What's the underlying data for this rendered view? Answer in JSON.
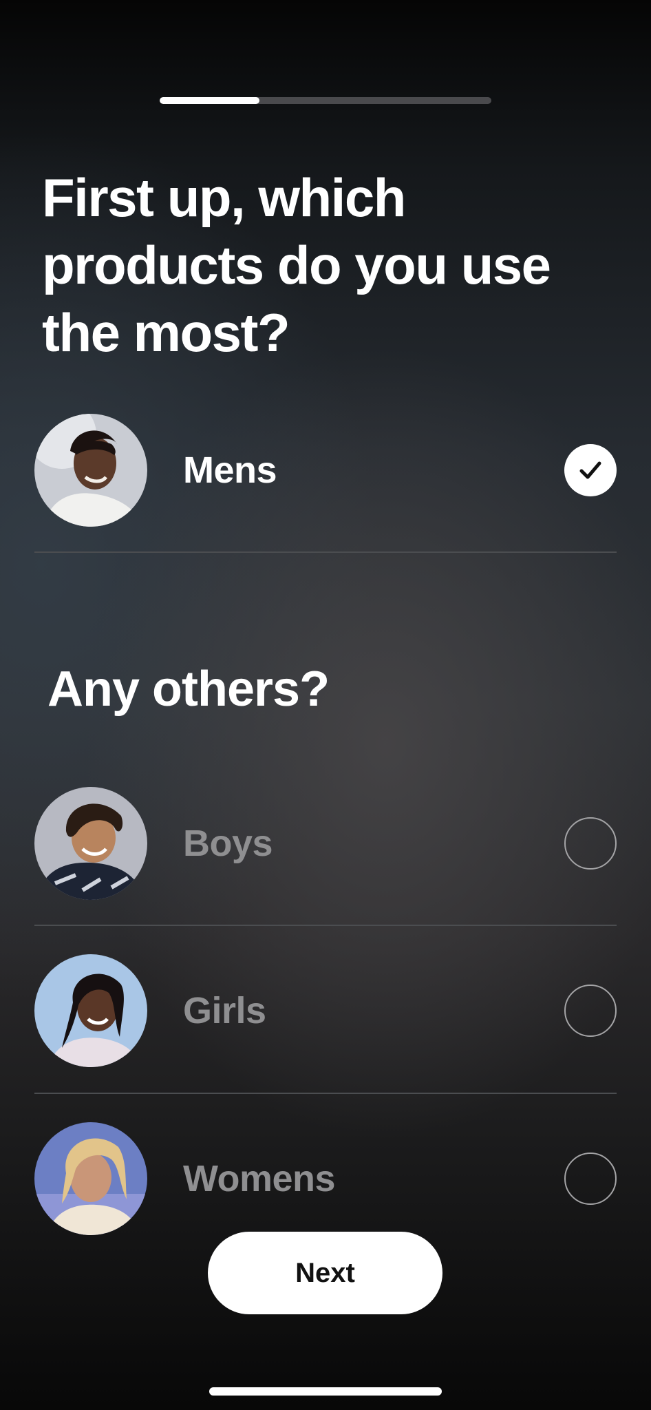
{
  "progress": {
    "value": 0.3
  },
  "question": {
    "title": "First up, which products do you use the most?"
  },
  "primary_option": {
    "label": "Mens",
    "selected": true,
    "avatar_icon": "mens-avatar-photo"
  },
  "others": {
    "title": "Any others?",
    "options": [
      {
        "label": "Boys",
        "selected": false,
        "avatar_icon": "boys-avatar-photo"
      },
      {
        "label": "Girls",
        "selected": false,
        "avatar_icon": "girls-avatar-photo"
      },
      {
        "label": "Womens",
        "selected": false,
        "avatar_icon": "womens-avatar-photo"
      }
    ]
  },
  "footer": {
    "next_label": "Next"
  },
  "colors": {
    "selected_text": "#ffffff",
    "unselected_text": "#8f8f91",
    "button_bg": "#ffffff",
    "progress_track": "#4a4a4d",
    "progress_fill": "#ffffff"
  }
}
